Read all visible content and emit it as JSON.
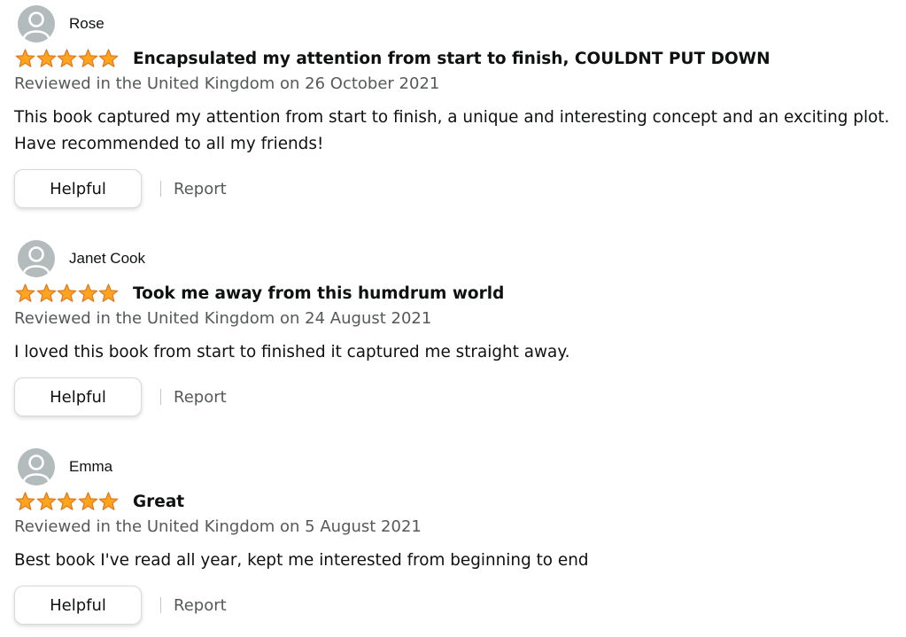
{
  "reviews": [
    {
      "reviewer": "Rose",
      "rating": 5,
      "title": "Encapsulated my attention from start to finish, COULDNT PUT DOWN",
      "meta": "Reviewed in the United Kingdom on 26 October 2021",
      "body": "This book captured my attention from start to finish, a unique and interesting concept and an exciting plot. Have recommended to all my friends!",
      "helpful_label": "Helpful",
      "report_label": "Report"
    },
    {
      "reviewer": "Janet Cook",
      "rating": 5,
      "title": "Took me away from this humdrum world",
      "meta": "Reviewed in the United Kingdom on 24 August 2021",
      "body": "I loved this book from start to finished it captured me straight away.",
      "helpful_label": "Helpful",
      "report_label": "Report"
    },
    {
      "reviewer": "Emma",
      "rating": 5,
      "title": "Great",
      "meta": "Reviewed in the United Kingdom on 5 August 2021",
      "body": "Best book I've read all year, kept me interested from beginning to end",
      "helpful_label": "Helpful",
      "report_label": "Report"
    }
  ],
  "icons": {
    "avatar": "default-avatar-icon",
    "star": "star-icon"
  },
  "colors": {
    "star_fill": "#ffa41c",
    "star_stroke": "#de7921",
    "avatar_bg": "#b3bbbd",
    "meta_text": "#565959"
  }
}
